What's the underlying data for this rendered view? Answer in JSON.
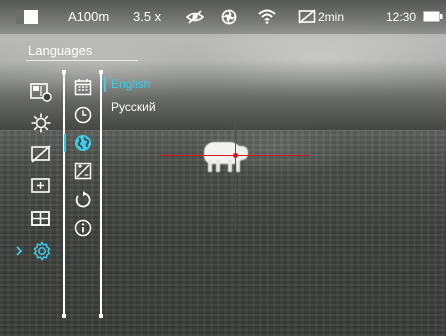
{
  "status_bar": {
    "distance": "A100m",
    "zoom": "3.5 x",
    "timer": "2min",
    "time": "12:30",
    "icons": [
      "device-mode-icon",
      "stealth-eye-off-icon",
      "aperture-icon",
      "wifi-icon",
      "display-off-timer-icon",
      "battery-icon"
    ]
  },
  "menu": {
    "title": "Languages",
    "main_items": [
      {
        "icon": "picture-in-picture-icon"
      },
      {
        "icon": "brightness-icon"
      },
      {
        "icon": "display-off-icon"
      },
      {
        "icon": "zoom-frame-icon"
      },
      {
        "icon": "layout-grid-icon"
      },
      {
        "icon": "settings-gear-icon",
        "active": true
      }
    ],
    "sub_items": [
      {
        "icon": "calendar-icon"
      },
      {
        "icon": "clock-icon"
      },
      {
        "icon": "globe-language-icon",
        "active": true
      },
      {
        "icon": "image-calibration-icon"
      },
      {
        "icon": "reset-icon"
      },
      {
        "icon": "info-icon"
      }
    ],
    "languages": [
      {
        "label": "English",
        "selected": true
      },
      {
        "label": "Русский",
        "selected": false
      }
    ],
    "colors": {
      "accent": "#3ecbe8",
      "reticle": "#d21c1c"
    }
  }
}
